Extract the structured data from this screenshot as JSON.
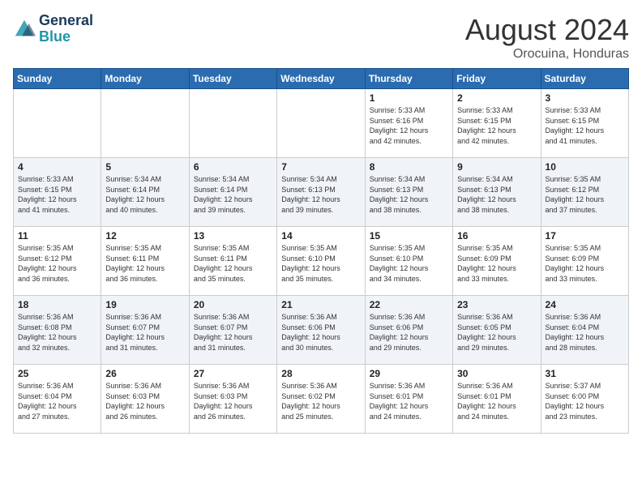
{
  "header": {
    "logo_line1": "General",
    "logo_line2": "Blue",
    "month_year": "August 2024",
    "location": "Orocuina, Honduras"
  },
  "days_of_week": [
    "Sunday",
    "Monday",
    "Tuesday",
    "Wednesday",
    "Thursday",
    "Friday",
    "Saturday"
  ],
  "weeks": [
    [
      {
        "day": "",
        "info": ""
      },
      {
        "day": "",
        "info": ""
      },
      {
        "day": "",
        "info": ""
      },
      {
        "day": "",
        "info": ""
      },
      {
        "day": "1",
        "info": "Sunrise: 5:33 AM\nSunset: 6:16 PM\nDaylight: 12 hours\nand 42 minutes."
      },
      {
        "day": "2",
        "info": "Sunrise: 5:33 AM\nSunset: 6:15 PM\nDaylight: 12 hours\nand 42 minutes."
      },
      {
        "day": "3",
        "info": "Sunrise: 5:33 AM\nSunset: 6:15 PM\nDaylight: 12 hours\nand 41 minutes."
      }
    ],
    [
      {
        "day": "4",
        "info": "Sunrise: 5:33 AM\nSunset: 6:15 PM\nDaylight: 12 hours\nand 41 minutes."
      },
      {
        "day": "5",
        "info": "Sunrise: 5:34 AM\nSunset: 6:14 PM\nDaylight: 12 hours\nand 40 minutes."
      },
      {
        "day": "6",
        "info": "Sunrise: 5:34 AM\nSunset: 6:14 PM\nDaylight: 12 hours\nand 39 minutes."
      },
      {
        "day": "7",
        "info": "Sunrise: 5:34 AM\nSunset: 6:13 PM\nDaylight: 12 hours\nand 39 minutes."
      },
      {
        "day": "8",
        "info": "Sunrise: 5:34 AM\nSunset: 6:13 PM\nDaylight: 12 hours\nand 38 minutes."
      },
      {
        "day": "9",
        "info": "Sunrise: 5:34 AM\nSunset: 6:13 PM\nDaylight: 12 hours\nand 38 minutes."
      },
      {
        "day": "10",
        "info": "Sunrise: 5:35 AM\nSunset: 6:12 PM\nDaylight: 12 hours\nand 37 minutes."
      }
    ],
    [
      {
        "day": "11",
        "info": "Sunrise: 5:35 AM\nSunset: 6:12 PM\nDaylight: 12 hours\nand 36 minutes."
      },
      {
        "day": "12",
        "info": "Sunrise: 5:35 AM\nSunset: 6:11 PM\nDaylight: 12 hours\nand 36 minutes."
      },
      {
        "day": "13",
        "info": "Sunrise: 5:35 AM\nSunset: 6:11 PM\nDaylight: 12 hours\nand 35 minutes."
      },
      {
        "day": "14",
        "info": "Sunrise: 5:35 AM\nSunset: 6:10 PM\nDaylight: 12 hours\nand 35 minutes."
      },
      {
        "day": "15",
        "info": "Sunrise: 5:35 AM\nSunset: 6:10 PM\nDaylight: 12 hours\nand 34 minutes."
      },
      {
        "day": "16",
        "info": "Sunrise: 5:35 AM\nSunset: 6:09 PM\nDaylight: 12 hours\nand 33 minutes."
      },
      {
        "day": "17",
        "info": "Sunrise: 5:35 AM\nSunset: 6:09 PM\nDaylight: 12 hours\nand 33 minutes."
      }
    ],
    [
      {
        "day": "18",
        "info": "Sunrise: 5:36 AM\nSunset: 6:08 PM\nDaylight: 12 hours\nand 32 minutes."
      },
      {
        "day": "19",
        "info": "Sunrise: 5:36 AM\nSunset: 6:07 PM\nDaylight: 12 hours\nand 31 minutes."
      },
      {
        "day": "20",
        "info": "Sunrise: 5:36 AM\nSunset: 6:07 PM\nDaylight: 12 hours\nand 31 minutes."
      },
      {
        "day": "21",
        "info": "Sunrise: 5:36 AM\nSunset: 6:06 PM\nDaylight: 12 hours\nand 30 minutes."
      },
      {
        "day": "22",
        "info": "Sunrise: 5:36 AM\nSunset: 6:06 PM\nDaylight: 12 hours\nand 29 minutes."
      },
      {
        "day": "23",
        "info": "Sunrise: 5:36 AM\nSunset: 6:05 PM\nDaylight: 12 hours\nand 29 minutes."
      },
      {
        "day": "24",
        "info": "Sunrise: 5:36 AM\nSunset: 6:04 PM\nDaylight: 12 hours\nand 28 minutes."
      }
    ],
    [
      {
        "day": "25",
        "info": "Sunrise: 5:36 AM\nSunset: 6:04 PM\nDaylight: 12 hours\nand 27 minutes."
      },
      {
        "day": "26",
        "info": "Sunrise: 5:36 AM\nSunset: 6:03 PM\nDaylight: 12 hours\nand 26 minutes."
      },
      {
        "day": "27",
        "info": "Sunrise: 5:36 AM\nSunset: 6:03 PM\nDaylight: 12 hours\nand 26 minutes."
      },
      {
        "day": "28",
        "info": "Sunrise: 5:36 AM\nSunset: 6:02 PM\nDaylight: 12 hours\nand 25 minutes."
      },
      {
        "day": "29",
        "info": "Sunrise: 5:36 AM\nSunset: 6:01 PM\nDaylight: 12 hours\nand 24 minutes."
      },
      {
        "day": "30",
        "info": "Sunrise: 5:36 AM\nSunset: 6:01 PM\nDaylight: 12 hours\nand 24 minutes."
      },
      {
        "day": "31",
        "info": "Sunrise: 5:37 AM\nSunset: 6:00 PM\nDaylight: 12 hours\nand 23 minutes."
      }
    ]
  ]
}
